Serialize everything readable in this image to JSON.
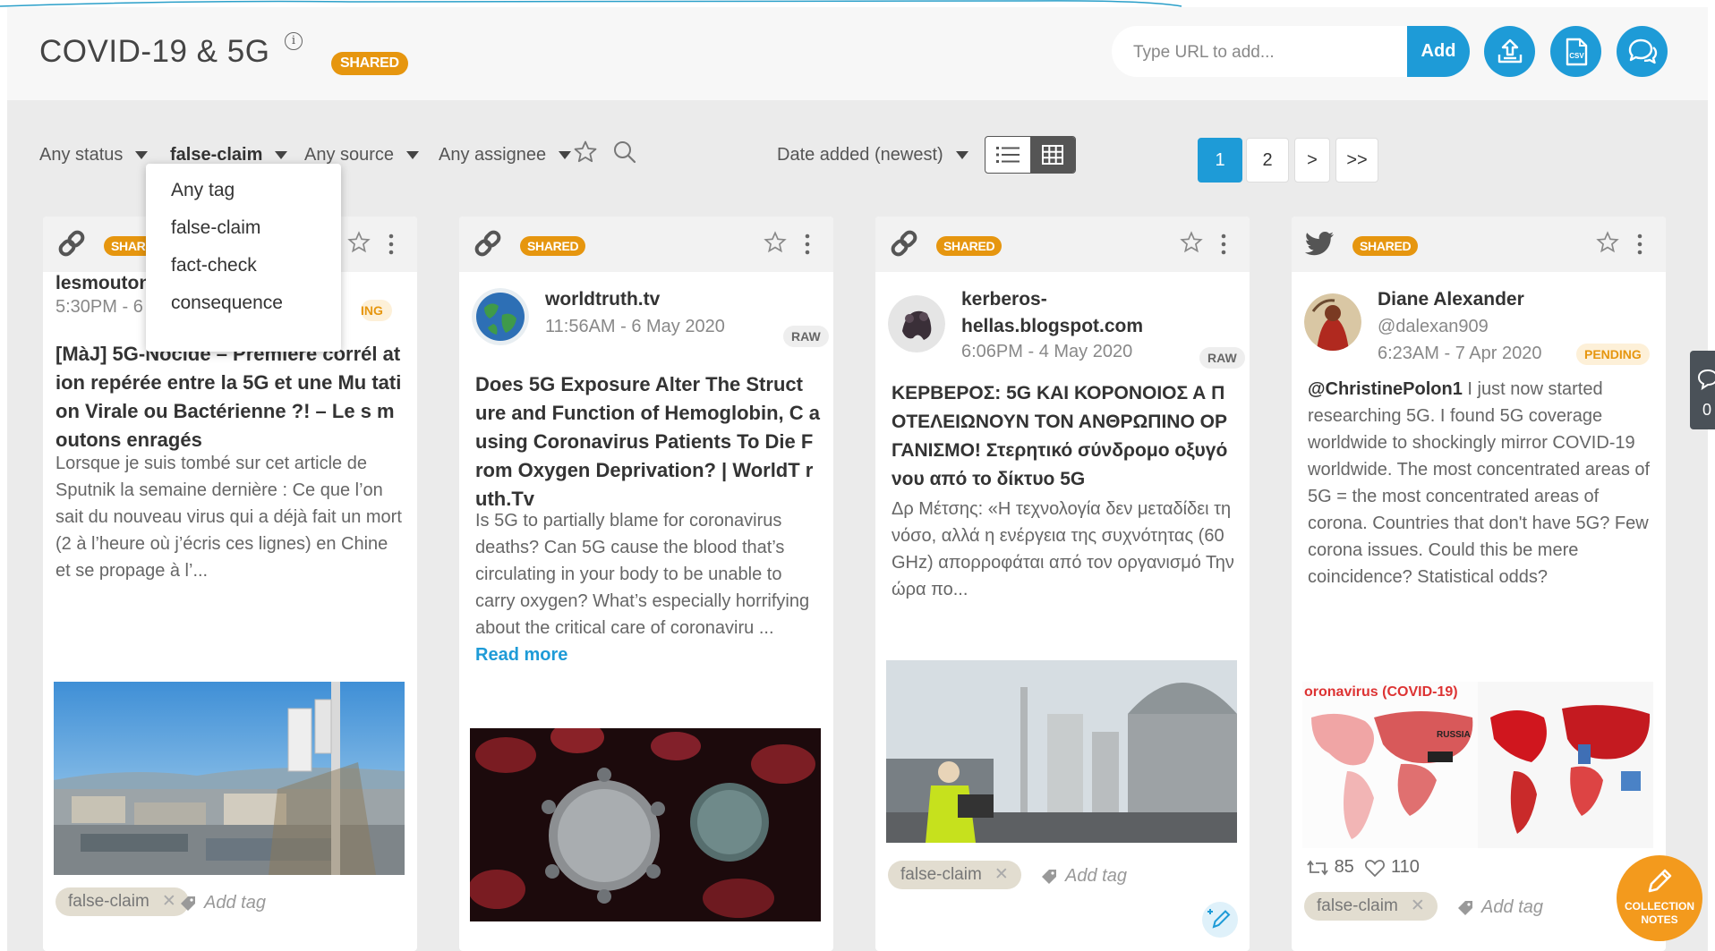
{
  "header": {
    "title": "COVID-19 & 5G",
    "shared_badge": "SHARED",
    "url_placeholder": "Type URL to add...",
    "add_label": "Add",
    "icons": [
      "upload-icon",
      "csv-export-icon",
      "comments-icon"
    ]
  },
  "filters": {
    "status": "Any status",
    "tag": "false-claim",
    "source": "Any source",
    "assignee": "Any assignee",
    "sort": "Date added (newest)"
  },
  "tag_dropdown": {
    "options": [
      "Any tag",
      "false-claim",
      "fact-check",
      "consequence"
    ]
  },
  "pagination": {
    "pages": [
      "1",
      "2"
    ],
    "current": "1",
    "next": ">",
    "last": ">>"
  },
  "cards": [
    {
      "source_type": "link",
      "badge": "SHARED",
      "author": "lesmoutonse",
      "time": "5:30PM - 6 Ma",
      "status": "ING",
      "title": "[MàJ] 5G-Nocide – Première corrél ation repérée entre la 5G et une Mu tation Virale ou Bactérienne ?! – Le s moutons enragés",
      "body": "Lorsque je suis tombé sur cet article de Sputnik la semaine dernière : Ce que l’on sait du nouveau virus qui a déjà fait un mort (2 à l’heure où j’écris ces lignes) en Chine et se propage à l’...",
      "tags": [
        "false-claim"
      ],
      "add_tag": "Add tag"
    },
    {
      "source_type": "link",
      "badge": "SHARED",
      "author": "worldtruth.tv",
      "time": "11:56AM - 6 May 2020",
      "status": "RAW",
      "title": "Does 5G Exposure Alter The Struct ure and Function of Hemoglobin, C ausing Coronavirus Patients To Die From Oxygen Deprivation? | WorldT ruth.Tv",
      "body": "Is 5G to partially blame for coronavirus deaths? Can 5G cause the blood that’s circulating in your body to be unable to carry oxygen? What’s especially horrifying about the critical care of coronaviru ... ",
      "read_more": "Read more"
    },
    {
      "source_type": "link",
      "badge": "SHARED",
      "author": "kerberos-hellas.blogspot.com",
      "time": "6:06PM - 4 May 2020",
      "status": "RAW",
      "title": "ΚΕΡΒΕΡΟΣ: 5G ΚΑΙ ΚΟΡΟΝΟΙΟΣ Α ΠΟΤΕΛΕΙΩΝΟΥΝ ΤΟΝ ΑΝΘΡΩΠΙΝΟ ΟΡΓΑΝΙΣΜΟ! Στερητικό σύνδρομο οξυγόνου από το δίκτυο 5G",
      "body": "Δρ Μέτσης: «Η τεχνολογία δεν μεταδίδει τη νόσο, αλλά η ενέργεια της συχνότητας (60 GHz) απορροφάται από τον οργανισμό Την ώρα πο...",
      "tags": [
        "false-claim"
      ],
      "add_tag": "Add tag"
    },
    {
      "source_type": "twitter",
      "badge": "SHARED",
      "author": "Diane Alexander",
      "handle": "@dalexan909",
      "time": "6:23AM - 7 Apr 2020",
      "status": "PENDING",
      "mention": "@ChristinePolon1",
      "body": " I just now started researching 5G. I found 5G coverage worldwide to shockingly mirror COVID-19 worldwide. The most concentrated areas of 5G = the most concentrated areas of corona. Countries that don't have 5G? Few corona issues. Could this be mere coincidence? Statistical odds?",
      "image_caption": "oronavirus (COVID-19)",
      "image_label": "RUSSIA",
      "retweets": "85",
      "likes": "110",
      "tags": [
        "false-claim"
      ],
      "add_tag": "Add tag"
    }
  ],
  "side_tab": {
    "count": "0"
  },
  "notes_fab": {
    "label": "COLLECTION NOTES"
  }
}
